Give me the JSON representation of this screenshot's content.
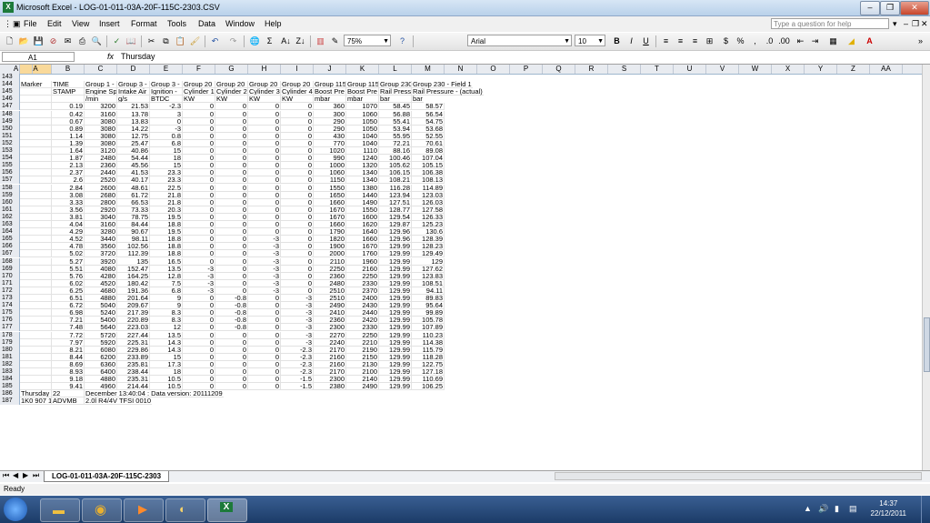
{
  "window": {
    "title": "Microsoft Excel - LOG-01-011-03A-20F-115C-2303.CSV"
  },
  "menu": [
    "File",
    "Edit",
    "View",
    "Insert",
    "Format",
    "Tools",
    "Data",
    "Window",
    "Help"
  ],
  "help_box": {
    "placeholder": "Type a question for help"
  },
  "toolbar": {
    "zoom": "75%",
    "font": "Arial",
    "size": "10"
  },
  "formula_bar": {
    "name_box": "A1",
    "fx": "fx",
    "content": "Thursday"
  },
  "columns": [
    "A",
    "B",
    "C",
    "D",
    "E",
    "F",
    "G",
    "H",
    "I",
    "J",
    "K",
    "L",
    "M",
    "N",
    "O",
    "P",
    "Q",
    "R",
    "S",
    "T",
    "U",
    "V",
    "W",
    "X",
    "Y",
    "Z",
    "AA",
    "A"
  ],
  "rows": [
    [
      "143"
    ],
    [
      "144",
      "Marker",
      "TIME",
      "Group 1 -",
      "Group 3 -",
      "Group 3 -",
      "Group 20",
      "Group 20",
      "Group 20",
      "Group 20",
      "Group 115",
      "Group 115",
      "Group 230",
      "Group 230 - Field 1"
    ],
    [
      "145",
      "",
      "STAMP",
      "Engine Sp",
      "Intake Air",
      "Ignition -",
      "Cylinder 1",
      "Cylinder 2",
      "Cylinder 3",
      "Cylinder 4",
      "Boost Pre",
      "Boost Pre",
      "Rail Press",
      "Rail Pressure - (actual)"
    ],
    [
      "146",
      "",
      "",
      "/min",
      "g/s",
      "BTDC",
      "KW",
      "KW",
      "KW",
      "KW",
      "mbar",
      "mbar",
      "bar",
      "bar"
    ],
    [
      "147",
      "",
      "0.19",
      "3200",
      "21.53",
      "-2.3",
      "0",
      "0",
      "0",
      "0",
      "360",
      "1070",
      "58.45",
      "58.57"
    ],
    [
      "148",
      "",
      "0.42",
      "3160",
      "13.78",
      "3",
      "0",
      "0",
      "0",
      "0",
      "300",
      "1060",
      "56.88",
      "56.54"
    ],
    [
      "149",
      "",
      "0.67",
      "3080",
      "13.83",
      "0",
      "0",
      "0",
      "0",
      "0",
      "290",
      "1050",
      "55.41",
      "54.75"
    ],
    [
      "150",
      "",
      "0.89",
      "3080",
      "14.22",
      "-3",
      "0",
      "0",
      "0",
      "0",
      "290",
      "1050",
      "53.94",
      "53.68"
    ],
    [
      "151",
      "",
      "1.14",
      "3080",
      "12.75",
      "0.8",
      "0",
      "0",
      "0",
      "0",
      "430",
      "1040",
      "55.95",
      "52.55"
    ],
    [
      "152",
      "",
      "1.39",
      "3080",
      "25.47",
      "6.8",
      "0",
      "0",
      "0",
      "0",
      "770",
      "1040",
      "72.21",
      "70.61"
    ],
    [
      "153",
      "",
      "1.64",
      "3120",
      "40.86",
      "15",
      "0",
      "0",
      "0",
      "0",
      "1020",
      "1110",
      "88.16",
      "89.08"
    ],
    [
      "154",
      "",
      "1.87",
      "2480",
      "54.44",
      "18",
      "0",
      "0",
      "0",
      "0",
      "990",
      "1240",
      "100.46",
      "107.04"
    ],
    [
      "155",
      "",
      "2.13",
      "2360",
      "45.56",
      "15",
      "0",
      "0",
      "0",
      "0",
      "1000",
      "1320",
      "105.62",
      "105.15"
    ],
    [
      "156",
      "",
      "2.37",
      "2440",
      "41.53",
      "23.3",
      "0",
      "0",
      "0",
      "0",
      "1060",
      "1340",
      "106.15",
      "106.38"
    ],
    [
      "157",
      "",
      "2.6",
      "2520",
      "40.17",
      "23.3",
      "0",
      "0",
      "0",
      "0",
      "1150",
      "1340",
      "108.21",
      "108.13"
    ],
    [
      "158",
      "",
      "2.84",
      "2600",
      "48.61",
      "22.5",
      "0",
      "0",
      "0",
      "0",
      "1550",
      "1380",
      "116.28",
      "114.89"
    ],
    [
      "159",
      "",
      "3.08",
      "2680",
      "61.72",
      "21.8",
      "0",
      "0",
      "0",
      "0",
      "1650",
      "1440",
      "123.94",
      "123.03"
    ],
    [
      "160",
      "",
      "3.33",
      "2800",
      "66.53",
      "21.8",
      "0",
      "0",
      "0",
      "0",
      "1660",
      "1490",
      "127.51",
      "126.03"
    ],
    [
      "161",
      "",
      "3.56",
      "2920",
      "73.33",
      "20.3",
      "0",
      "0",
      "0",
      "0",
      "1670",
      "1550",
      "128.77",
      "127.58"
    ],
    [
      "162",
      "",
      "3.81",
      "3040",
      "78.75",
      "19.5",
      "0",
      "0",
      "0",
      "0",
      "1670",
      "1600",
      "129.54",
      "126.33"
    ],
    [
      "163",
      "",
      "4.04",
      "3160",
      "84.44",
      "18.8",
      "0",
      "0",
      "0",
      "0",
      "1660",
      "1620",
      "129.87",
      "125.23"
    ],
    [
      "164",
      "",
      "4.29",
      "3280",
      "90.67",
      "19.5",
      "0",
      "0",
      "0",
      "0",
      "1790",
      "1640",
      "129.96",
      "130.6"
    ],
    [
      "165",
      "",
      "4.52",
      "3440",
      "98.11",
      "18.8",
      "0",
      "0",
      "-3",
      "0",
      "1820",
      "1660",
      "129.96",
      "128.39"
    ],
    [
      "166",
      "",
      "4.78",
      "3560",
      "102.56",
      "18.8",
      "0",
      "0",
      "-3",
      "0",
      "1900",
      "1670",
      "129.99",
      "128.23"
    ],
    [
      "167",
      "",
      "5.02",
      "3720",
      "112.39",
      "18.8",
      "0",
      "0",
      "-3",
      "0",
      "2000",
      "1760",
      "129.99",
      "129.49"
    ],
    [
      "168",
      "",
      "5.27",
      "3920",
      "135",
      "16.5",
      "0",
      "0",
      "-3",
      "0",
      "2110",
      "1960",
      "129.99",
      "129"
    ],
    [
      "169",
      "",
      "5.51",
      "4080",
      "152.47",
      "13.5",
      "-3",
      "0",
      "-3",
      "0",
      "2250",
      "2160",
      "129.99",
      "127.62"
    ],
    [
      "170",
      "",
      "5.76",
      "4280",
      "164.25",
      "12.8",
      "-3",
      "0",
      "-3",
      "0",
      "2360",
      "2250",
      "129.99",
      "123.83"
    ],
    [
      "171",
      "",
      "6.02",
      "4520",
      "180.42",
      "7.5",
      "-3",
      "0",
      "-3",
      "0",
      "2480",
      "2330",
      "129.99",
      "108.51"
    ],
    [
      "172",
      "",
      "6.25",
      "4680",
      "191.36",
      "6.8",
      "-3",
      "0",
      "-3",
      "0",
      "2510",
      "2370",
      "129.99",
      "94.11"
    ],
    [
      "173",
      "",
      "6.51",
      "4880",
      "201.64",
      "9",
      "0",
      "-0.8",
      "0",
      "-3",
      "2510",
      "2400",
      "129.99",
      "89.83"
    ],
    [
      "174",
      "",
      "6.72",
      "5040",
      "209.67",
      "9",
      "0",
      "-0.8",
      "0",
      "-3",
      "2490",
      "2430",
      "129.99",
      "95.64"
    ],
    [
      "175",
      "",
      "6.98",
      "5240",
      "217.39",
      "8.3",
      "0",
      "-0.8",
      "0",
      "-3",
      "2410",
      "2440",
      "129.99",
      "99.89"
    ],
    [
      "176",
      "",
      "7.21",
      "5400",
      "220.89",
      "8.3",
      "0",
      "-0.8",
      "0",
      "-3",
      "2360",
      "2420",
      "129.99",
      "105.78"
    ],
    [
      "177",
      "",
      "7.48",
      "5640",
      "223.03",
      "12",
      "0",
      "-0.8",
      "0",
      "-3",
      "2300",
      "2330",
      "129.99",
      "107.89"
    ],
    [
      "178",
      "",
      "7.72",
      "5720",
      "227.44",
      "13.5",
      "0",
      "0",
      "0",
      "-3",
      "2270",
      "2250",
      "129.99",
      "110.23"
    ],
    [
      "179",
      "",
      "7.97",
      "5920",
      "225.31",
      "14.3",
      "0",
      "0",
      "0",
      "-3",
      "2240",
      "2210",
      "129.99",
      "114.38"
    ],
    [
      "180",
      "",
      "8.21",
      "6080",
      "229.86",
      "14.3",
      "0",
      "0",
      "0",
      "-2.3",
      "2170",
      "2190",
      "129.99",
      "115.79"
    ],
    [
      "181",
      "",
      "8.44",
      "6200",
      "233.89",
      "15",
      "0",
      "0",
      "0",
      "-2.3",
      "2160",
      "2150",
      "129.99",
      "118.28"
    ],
    [
      "182",
      "",
      "8.69",
      "6360",
      "235.81",
      "17.3",
      "0",
      "0",
      "0",
      "-2.3",
      "2160",
      "2130",
      "129.99",
      "122.75"
    ],
    [
      "183",
      "",
      "8.93",
      "6400",
      "238.44",
      "18",
      "0",
      "0",
      "0",
      "-2.3",
      "2170",
      "2100",
      "129.99",
      "127.18"
    ],
    [
      "184",
      "",
      "9.18",
      "4880",
      "235.31",
      "10.5",
      "0",
      "0",
      "0",
      "-1.5",
      "2300",
      "2140",
      "129.99",
      "110.69"
    ],
    [
      "185",
      "",
      "9.41",
      "4960",
      "214.44",
      "10.5",
      "0",
      "0",
      "0",
      "-1.5",
      "2380",
      "2490",
      "129.99",
      "106.25"
    ],
    [
      "186",
      "Thursday",
      "22",
      "December 13:40:04 : Data version: 20111209"
    ],
    [
      "187",
      "1K0 907 1",
      "ADVMB",
      "2.0l R4/4V TFSI    0010"
    ]
  ],
  "sheet_tab": "LOG-01-011-03A-20F-115C-2303",
  "status": "Ready",
  "clock": {
    "time": "14:37",
    "date": "22/12/2011"
  }
}
